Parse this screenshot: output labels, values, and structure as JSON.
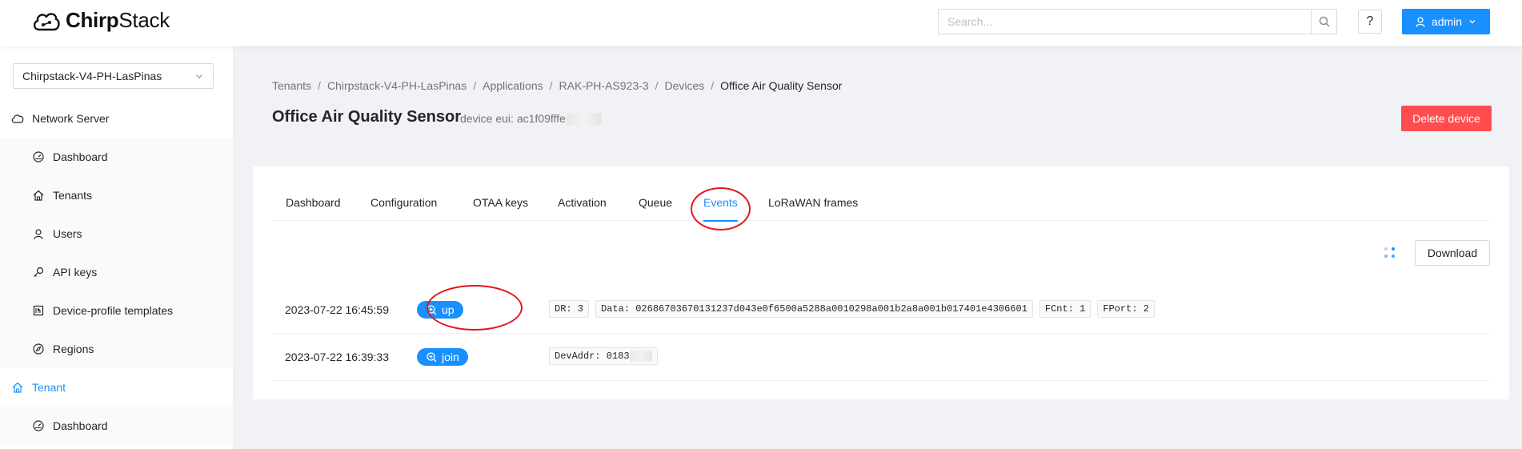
{
  "header": {
    "logo_text_bold": "Chirp",
    "logo_text_light": "Stack",
    "search_placeholder": "Search...",
    "help_label": "?",
    "user_label": "admin"
  },
  "sidebar": {
    "tenant_selected": "Chirpstack-V4-PH-LasPinas",
    "network_server_label": "Network Server",
    "ns_items": [
      {
        "label": "Dashboard",
        "icon": "dashboard-icon"
      },
      {
        "label": "Tenants",
        "icon": "home-icon"
      },
      {
        "label": "Users",
        "icon": "user-icon"
      },
      {
        "label": "API keys",
        "icon": "key-icon"
      },
      {
        "label": "Device-profile templates",
        "icon": "template-icon"
      },
      {
        "label": "Regions",
        "icon": "compass-icon"
      }
    ],
    "tenant_label": "Tenant",
    "tenant_items": [
      {
        "label": "Dashboard",
        "icon": "dashboard-icon"
      }
    ]
  },
  "breadcrumb": [
    "Tenants",
    "Chirpstack-V4-PH-LasPinas",
    "Applications",
    "RAK-PH-AS923-3",
    "Devices",
    "Office Air Quality Sensor"
  ],
  "page": {
    "title": "Office Air Quality Sensor",
    "subtitle": "device eui: ac1f09fffe",
    "delete_label": "Delete device"
  },
  "tabs": [
    "Dashboard",
    "Configuration",
    "OTAA keys",
    "Activation",
    "Queue",
    "Events",
    "LoRaWAN frames"
  ],
  "active_tab": "Events",
  "download_label": "Download",
  "events": [
    {
      "time": "2023-07-22 16:45:59",
      "type": "up",
      "codes": [
        "DR: 3",
        "Data: 02686703670131237d043e0f6500a5288a0010298a001b2a8a001b017401e4306601",
        "FCnt: 1",
        "FPort: 2"
      ]
    },
    {
      "time": "2023-07-22 16:39:33",
      "type": "join",
      "codes": [
        "DevAddr: 0183"
      ]
    }
  ],
  "colors": {
    "primary": "#1890ff",
    "danger": "#ff4d4f",
    "annotation": "#e4161c"
  }
}
